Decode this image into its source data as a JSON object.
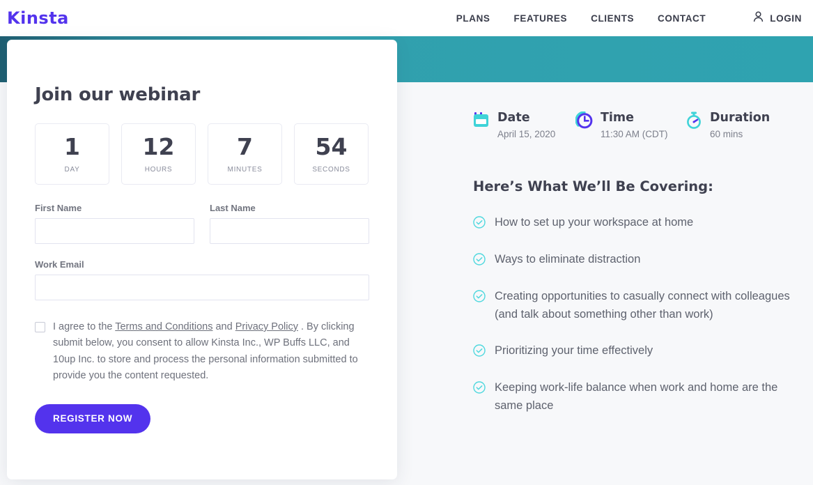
{
  "nav": {
    "logo": "Kinsta",
    "links": [
      {
        "label": "PLANS"
      },
      {
        "label": "FEATURES"
      },
      {
        "label": "CLIENTS"
      },
      {
        "label": "CONTACT"
      }
    ],
    "login_label": "LOGIN",
    "login_icon": "user-icon"
  },
  "card": {
    "title": "Join our webinar",
    "countdown": [
      {
        "value": "1",
        "label": "DAY"
      },
      {
        "value": "12",
        "label": "HOURS"
      },
      {
        "value": "7",
        "label": "MINUTES"
      },
      {
        "value": "54",
        "label": "SECONDS"
      }
    ],
    "form": {
      "first_name_label": "First Name",
      "first_name_value": "",
      "last_name_label": "Last Name",
      "last_name_value": "",
      "work_email_label": "Work Email",
      "work_email_value": ""
    },
    "consent": {
      "checked": false,
      "part1": "I agree to the ",
      "terms_link": "Terms and Conditions",
      "part2": " and ",
      "privacy_link": "Privacy Policy",
      "part3": " . By clicking submit below, you consent to allow Kinsta Inc., WP Buffs LLC, and 10up Inc. to store and process the personal information submitted to provide you the content requested."
    },
    "submit_label": "REGISTER NOW"
  },
  "details": {
    "date": {
      "icon": "calendar-icon",
      "title": "Date",
      "value": "April 15, 2020"
    },
    "time": {
      "icon": "clock-icon",
      "title": "Time",
      "value": "11:30 AM (CDT)"
    },
    "duration": {
      "icon": "stopwatch-icon",
      "title": "Duration",
      "value": "60 mins"
    }
  },
  "covering": {
    "title": "Here’s What We’ll Be Covering:",
    "items": [
      "How to set up your workspace at home",
      "Ways to eliminate distraction",
      "Creating opportunities to casually connect with colleagues (and talk about something other than work)",
      "Prioritizing your time effectively",
      "Keeping work-life balance when work and home are the same place"
    ]
  },
  "colors": {
    "brand_purple": "#5333ed",
    "banner_teal": "#31a0ae",
    "accent_turquoise": "#3fd3d8",
    "text_dark": "#3f4150"
  }
}
